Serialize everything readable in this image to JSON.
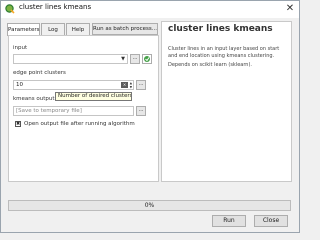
{
  "window": {
    "title": "cluster lines kmeans",
    "close_glyph": "✕",
    "icon": "qgis-icon"
  },
  "tabs": [
    {
      "label": "Parameters",
      "active": true
    },
    {
      "label": "Log",
      "active": false
    },
    {
      "label": "Help",
      "active": false
    }
  ],
  "batch_button": {
    "label": "Run as batch process..."
  },
  "params": {
    "input": {
      "label": "input",
      "value": "",
      "browse_label": "...",
      "icon": "iterate-icon"
    },
    "edge_point_clusters": {
      "label": "edge point clusters",
      "value": "10",
      "clear_icon": "clear-icon",
      "browse_label": "..."
    },
    "kmeans_output": {
      "label": "kmeans output",
      "placeholder": "[Save to temporary file]",
      "browse_label": "..."
    },
    "open_output": {
      "label": "Open output file after running algorithm",
      "checked": true,
      "check_glyph": "✖"
    }
  },
  "tooltip": {
    "text": "Number of desired clusters"
  },
  "help": {
    "title": "cluster lines kmeans",
    "description": "Cluster lines in an input layer based on start and end location using kmeans clustering.",
    "dependency": "Depends on scikit learn (sklearn)."
  },
  "progress": {
    "value_fraction": 0.0,
    "text": "0%"
  },
  "buttons": {
    "run": "Run",
    "close": "Close"
  },
  "colors": {
    "progress_fill": "#06b025",
    "tooltip_bg": "#ffffe1"
  }
}
